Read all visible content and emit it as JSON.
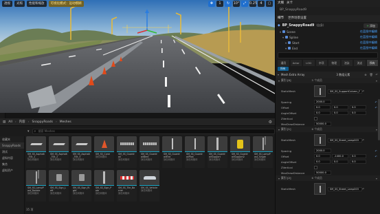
{
  "viewport": {
    "buttons": [
      "透视",
      "光照",
      "性能和缩放",
      "可视化模式",
      "运行时隐藏"
    ],
    "warning_label": "可视化模式：运动模糊",
    "right_icons": [
      "1",
      "10°",
      "0.25",
      "4"
    ]
  },
  "content_browser": {
    "breadcrumb": [
      "All",
      "内容",
      "SnappyRoads",
      "Meshes"
    ],
    "search_placeholder": "搜索 Meshes",
    "tree": [
      "收藏夹",
      "SnappyRoads",
      "测试",
      "虚拟内容",
      "集合",
      "虚拟资产"
    ],
    "tiles": [
      {
        "name": "SM_SS_Asphalt_Tile_1",
        "type": "静态网格体",
        "shape": "flat"
      },
      {
        "name": "SM_SS_Asphalt_Tile_2",
        "type": "静态网格体",
        "shape": "flat"
      },
      {
        "name": "SM_SS_Asphalt_Tile_3",
        "type": "静态网格体",
        "shape": "flat"
      },
      {
        "name": "SM_SS_Cone",
        "type": "静态网格体",
        "shape": "cone"
      },
      {
        "name": "SM_SS_Guardrail",
        "type": "静态网格体",
        "shape": "rail"
      },
      {
        "name": "SM_SS_GuardrailBent",
        "type": "静态网格体",
        "shape": "rail"
      },
      {
        "name": "SM_SS_GuardrailEnd",
        "type": "静态网格体",
        "shape": "bar"
      },
      {
        "name": "SM_SS_GuardrailPost",
        "type": "静态网格体",
        "shape": "bar"
      },
      {
        "name": "SM_SS_GuardrailSupport",
        "type": "静态网格体",
        "shape": "post"
      },
      {
        "name": "SM_SS_GuardrailSupport2",
        "type": "静态网格体",
        "shape": "barrel"
      },
      {
        "name": "SM_SS_LampPost_Single",
        "type": "静态网格体",
        "shape": "lamp"
      },
      {
        "name": "SM_SS_LampPost_Double",
        "type": "静态网格体",
        "shape": "lamp"
      },
      {
        "name": "SM_SS_Sign_Left",
        "type": "静态网格体",
        "shape": "sign"
      },
      {
        "name": "SM_SS_Sign_Right",
        "type": "静态网格体",
        "shape": "sign"
      },
      {
        "name": "SM_SS_Sign_Pole",
        "type": "静态网格体",
        "shape": "post"
      },
      {
        "name": "SM_SS_Tile_Barrier",
        "type": "静态网格体",
        "shape": "barrier"
      },
      {
        "name": "SM_SS_Vehicle",
        "type": "静态网格体",
        "shape": "car"
      }
    ],
    "status": "35 项"
  },
  "outliner": {
    "tabs": [
      "大纲",
      "关卡"
    ],
    "row": "BP_SnappyRoad9"
  },
  "details": {
    "tabs": [
      "细节",
      "世界场景设置"
    ],
    "bp_name": "BP_SnappyRoad9",
    "bp_suffix": "(自身)",
    "add_label": "添加",
    "tree": [
      {
        "label": "Scene",
        "edit": "在蓝图中编辑"
      },
      {
        "label": "Spline",
        "edit": "在蓝图中编辑"
      },
      {
        "label": "Start",
        "edit": "在蓝图中编辑"
      },
      {
        "label": "End",
        "edit": "在蓝图中编辑"
      }
    ],
    "categories": [
      "通用",
      "Actor",
      "LOD",
      "杂项",
      "物理",
      "渲染",
      "流送",
      "所有"
    ],
    "sub_tab": "所有",
    "array_label": "Mesh Extra Array",
    "array_count": "3 数组元素",
    "elements": [
      {
        "index": "索引 [0]",
        "members": "5 个成员",
        "mesh": "SM_SS_SupportColumn_F",
        "spacing": "2000.0",
        "offset": [
          "0.0",
          "0.0",
          "0.0"
        ],
        "angle": [
          "0.0",
          "0.0",
          "0.0"
        ],
        "max_draw": "50000.0"
      },
      {
        "index": "索引 [1]",
        "members": "6 个成员",
        "mesh": "SM_SS_Street_Lamp003",
        "spacing": "2000.0",
        "offset": [
          "0.0",
          "-1400.0",
          "0.0"
        ],
        "angle": [
          "0.0",
          "0.0",
          "0.0"
        ],
        "max_draw": "50000.0"
      },
      {
        "index": "索引 [2]",
        "members": "6 个成员",
        "mesh": "SM_SS_Street_Lamp003"
      }
    ],
    "labels": {
      "static_mesh": "StaticMesh",
      "spacing": "Spacing",
      "offset": "Offset",
      "angle_offset": "AngleOffset",
      "z_vertical": "ZVertical",
      "max_draw": "MaxDrawDistance"
    }
  }
}
